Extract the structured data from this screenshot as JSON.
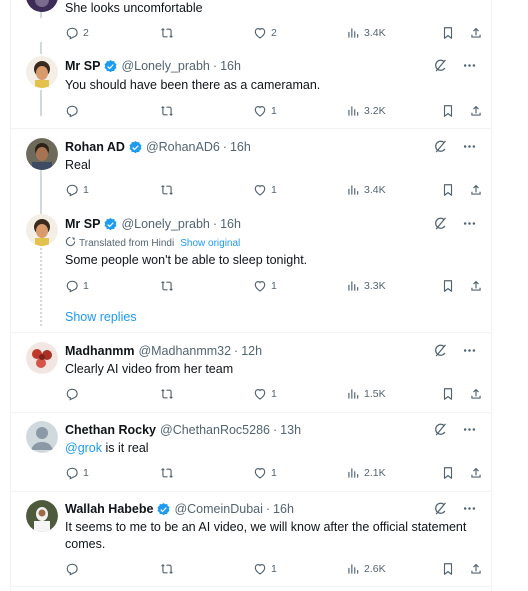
{
  "posts": [
    {
      "text": "She looks uncomfortable",
      "replies": "2",
      "reposts": "",
      "likes": "2",
      "views": "3.4K"
    },
    {
      "name": "Mr SP",
      "handle": "@Lonely_prabh",
      "time": "16h",
      "text": "You should have been there as a cameraman.",
      "replies": "",
      "reposts": "",
      "likes": "1",
      "views": "3.2K"
    },
    {
      "name": "Rohan AD",
      "handle": "@RohanAD6",
      "time": "16h",
      "text": "Real",
      "replies": "1",
      "reposts": "",
      "likes": "1",
      "views": "3.4K"
    },
    {
      "name": "Mr SP",
      "handle": "@Lonely_prabh",
      "time": "16h",
      "translated": "Translated from Hindi",
      "show_original": "Show original",
      "text": "Some people won't be able to sleep tonight.",
      "replies": "1",
      "reposts": "",
      "likes": "1",
      "views": "3.3K"
    },
    {
      "name": "Madhanmm",
      "handle": "@Madhanmm32",
      "time": "12h",
      "text": "Clearly AI video from her team",
      "replies": "",
      "reposts": "",
      "likes": "1",
      "views": "1.5K"
    },
    {
      "name": "Chethan Rocky",
      "handle": "@ChethanRoc5286",
      "time": "13h",
      "mention": "@grok",
      "text_rest": " is it real",
      "replies": "1",
      "reposts": "",
      "likes": "1",
      "views": "2.1K"
    },
    {
      "name": "Wallah Habebe",
      "handle": "@ComeinDubai",
      "time": "16h",
      "text_line1": "It seems to me to be an AI video, we will know after the official statement",
      "text_line2": "comes.",
      "replies": "",
      "reposts": "",
      "likes": "1",
      "views": "2.6K"
    }
  ],
  "show_replies": "Show replies",
  "separator": "·",
  "icons": {
    "verified": "verified-badge-icon",
    "grok": "grok-icon",
    "more": "more-icon",
    "reply": "reply-icon",
    "repost": "repost-icon",
    "like": "like-icon",
    "views": "views-icon",
    "bookmark": "bookmark-icon",
    "share": "share-icon"
  },
  "colors": {
    "accent": "#1d9bf0",
    "muted": "#536471",
    "text": "#0f1419",
    "border": "#eff3f4"
  }
}
